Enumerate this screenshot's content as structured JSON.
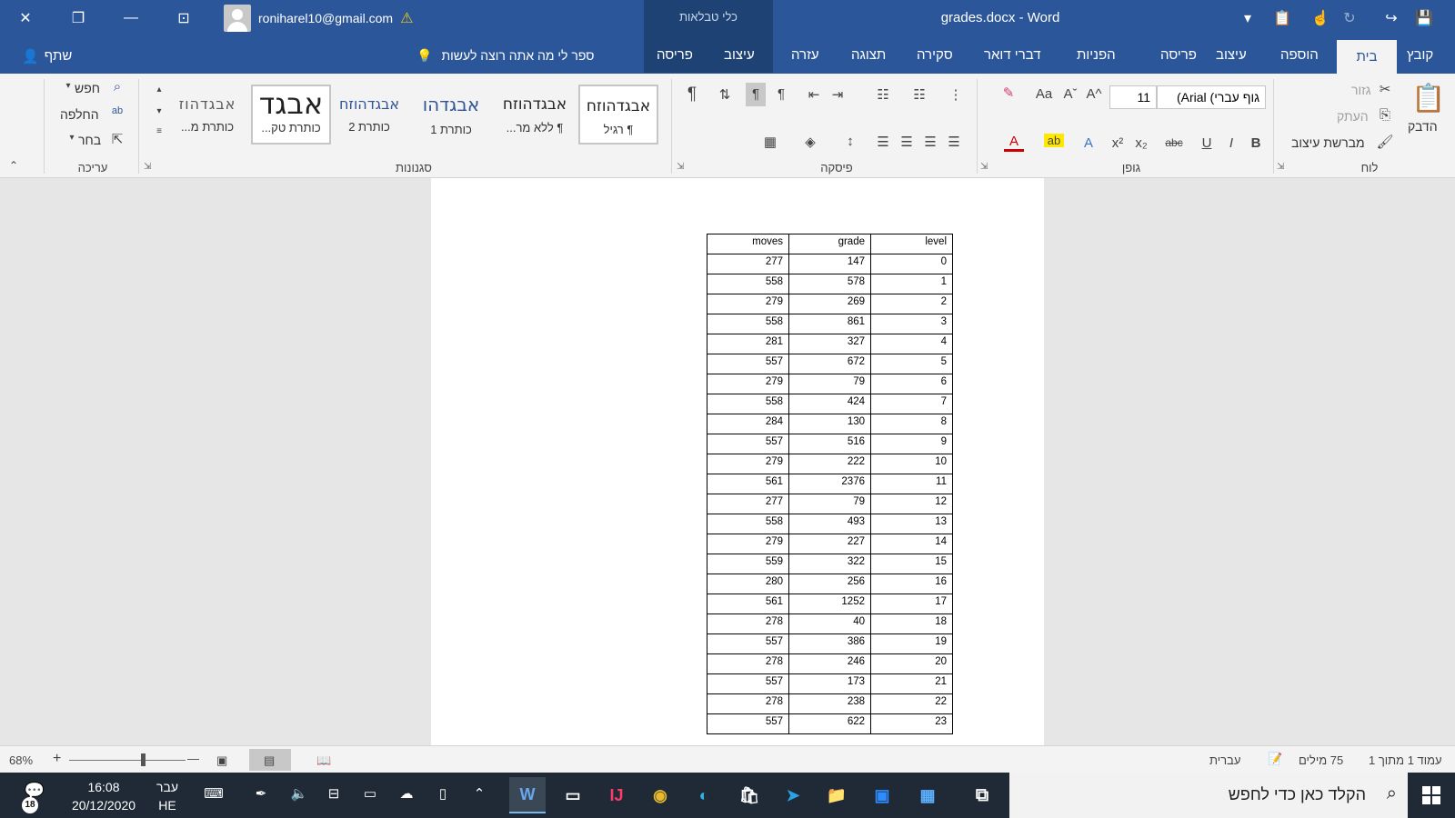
{
  "titlebar": {
    "doc_title": "grades.docx  -  Word",
    "context_title": "כלי טבלאות",
    "account_email": "roniharel10@gmail.com",
    "warning_glyph": "⚠",
    "close_glyph": "✕",
    "restore_glyph": "❐",
    "minimize_glyph": "—",
    "ribbon_display_glyph": "⊡",
    "save_glyph": "💾",
    "redo_glyph": "↪",
    "undo_glyph": "↻",
    "touch_glyph": "☝",
    "paste_glyph": "📋",
    "customize_glyph": "▾"
  },
  "tabs": {
    "file": "קובץ",
    "home": "בית",
    "insert": "הוספה",
    "design": "עיצוב",
    "layout": "פריסה",
    "references": "הפניות",
    "mailings": "דברי דואר",
    "review": "סקירה",
    "view": "תצוגה",
    "help": "עזרה",
    "table_design": "עיצוב",
    "table_layout": "פריסה",
    "tell_me": "ספר לי מה אתה רוצה לעשות",
    "share": "שתף"
  },
  "ribbon": {
    "clipboard": {
      "label": "לוח",
      "paste": "הדבק",
      "cut": "גזור",
      "copy": "העתק",
      "format_painter": "מברשת עיצוב"
    },
    "font": {
      "label": "גופן",
      "font_name": "גוף עברי) Arial)",
      "font_size": "11",
      "bold": "B",
      "italic": "I",
      "underline": "U",
      "strike": "abc",
      "subscript": "x₂",
      "superscript": "x²",
      "grow": "A^",
      "shrink": "Aˇ",
      "change_case": "Aa",
      "text_effects": "A",
      "highlight": "ab",
      "font_color": "A",
      "clear_format": "✎"
    },
    "paragraph": {
      "label": "פיסקה",
      "pilcrow": "¶"
    },
    "styles": {
      "label": "סגנונות",
      "items": [
        {
          "sample": "אבגדהוזח",
          "name": "¶ רגיל"
        },
        {
          "sample": "אבגדהוזח",
          "name": "¶ ללא מר..."
        },
        {
          "sample": "אבגדהו",
          "name": "כותרת 1"
        },
        {
          "sample": "אבגדהוזח",
          "name": "כותרת 2"
        },
        {
          "sample": "אבגד",
          "name": "כותרת טק..."
        },
        {
          "sample": "אבגדהוז",
          "name": "כותרת מ..."
        }
      ]
    },
    "editing": {
      "label": "עריכה",
      "find": "חפש",
      "replace": "החלפה",
      "select": "בחר"
    }
  },
  "table": {
    "headers": [
      "moves",
      "grade",
      "level"
    ],
    "rows": [
      [
        "277",
        "147",
        "0"
      ],
      [
        "558",
        "578",
        "1"
      ],
      [
        "279",
        "269",
        "2"
      ],
      [
        "558",
        "861",
        "3"
      ],
      [
        "281",
        "327",
        "4"
      ],
      [
        "557",
        "672",
        "5"
      ],
      [
        "279",
        "79",
        "6"
      ],
      [
        "558",
        "424",
        "7"
      ],
      [
        "284",
        "130",
        "8"
      ],
      [
        "557",
        "516",
        "9"
      ],
      [
        "279",
        "222",
        "10"
      ],
      [
        "561",
        "2376",
        "11"
      ],
      [
        "277",
        "79",
        "12"
      ],
      [
        "558",
        "493",
        "13"
      ],
      [
        "279",
        "227",
        "14"
      ],
      [
        "559",
        "322",
        "15"
      ],
      [
        "280",
        "256",
        "16"
      ],
      [
        "561",
        "1252",
        "17"
      ],
      [
        "278",
        "40",
        "18"
      ],
      [
        "557",
        "386",
        "19"
      ],
      [
        "278",
        "246",
        "20"
      ],
      [
        "557",
        "173",
        "21"
      ],
      [
        "278",
        "238",
        "22"
      ],
      [
        "557",
        "622",
        "23"
      ]
    ]
  },
  "statusbar": {
    "page": "עמוד 1 מתוך 1",
    "words": "75 מילים",
    "language": "עברית",
    "zoom": "68%",
    "zoom_plus": "+",
    "zoom_minus": "—"
  },
  "taskbar": {
    "search_placeholder": "הקלד כאן כדי לחפש",
    "time": "16:08",
    "date": "20/12/2020",
    "input_lang": "עבר",
    "input_lang_code": "HE",
    "notification_count": "18"
  },
  "colors": {
    "word_blue": "#2b579a",
    "ribbon_bg": "#f3f3f3",
    "taskbar_bg": "#1f2a36"
  }
}
